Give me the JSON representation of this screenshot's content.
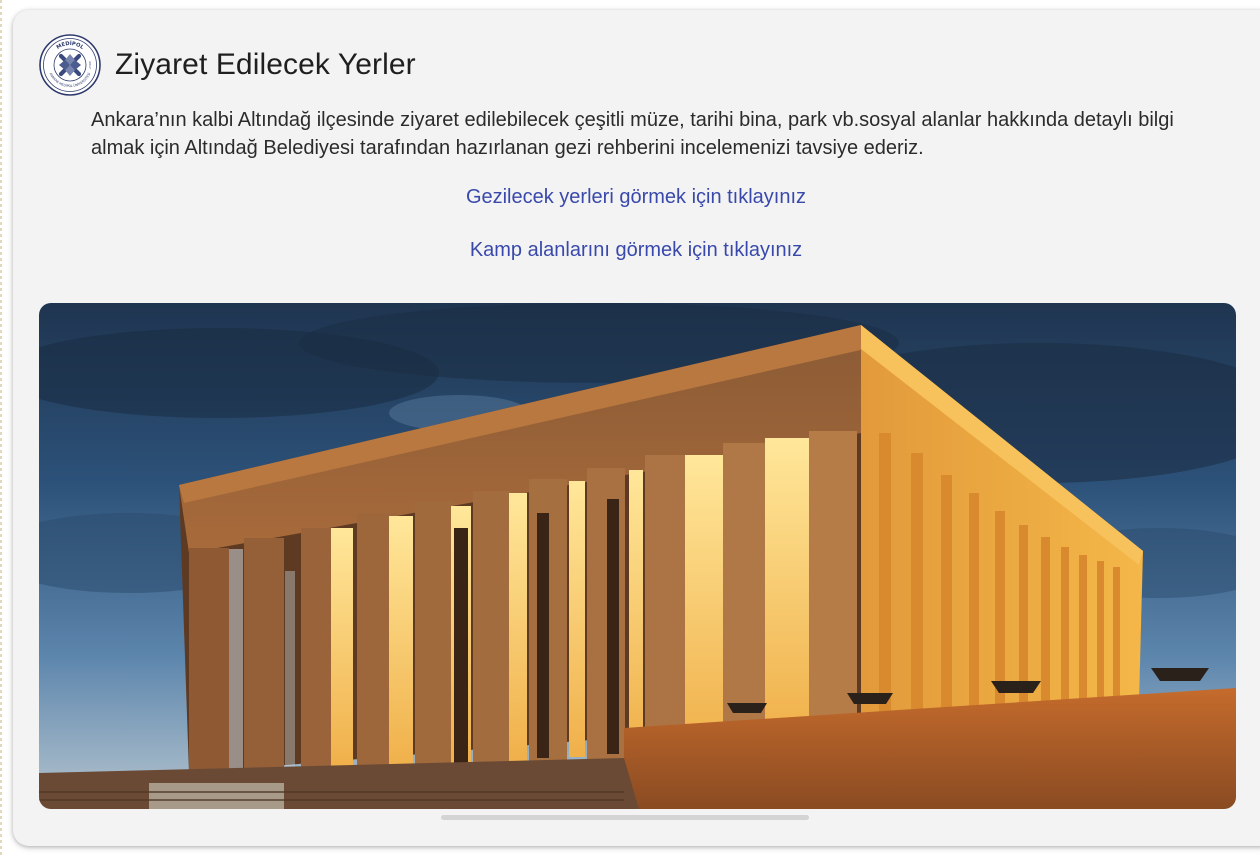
{
  "card": {
    "title": "Ziyaret Edilecek Yerler",
    "description": "Ankara’nın kalbi Altındağ ilçesinde ziyaret edilebilecek çeşitli müze, tarihi bina, park vb.sosyal alanlar hakkında detaylı bilgi almak için Altındağ Belediyesi tarafından hazırlanan gezi rehberini incelemenizi tavsiye ederiz.",
    "links": [
      {
        "label": "Gezilecek yerleri görmek için tıklayınız"
      },
      {
        "label": "Kamp alanlarını görmek için tıklayınız"
      }
    ]
  },
  "logo": {
    "icon": "university-seal-icon",
    "text_top": "MEDİPOL",
    "text_bottom": "ANKARA MEDİPOL ÜNİVERSİTESİ",
    "year": "2017"
  },
  "image": {
    "subject": "anitkabir-mausoleum-photo"
  },
  "colors": {
    "link": "#3949ab",
    "card_background": "#f3f3f3",
    "title": "#1f1f1f"
  }
}
